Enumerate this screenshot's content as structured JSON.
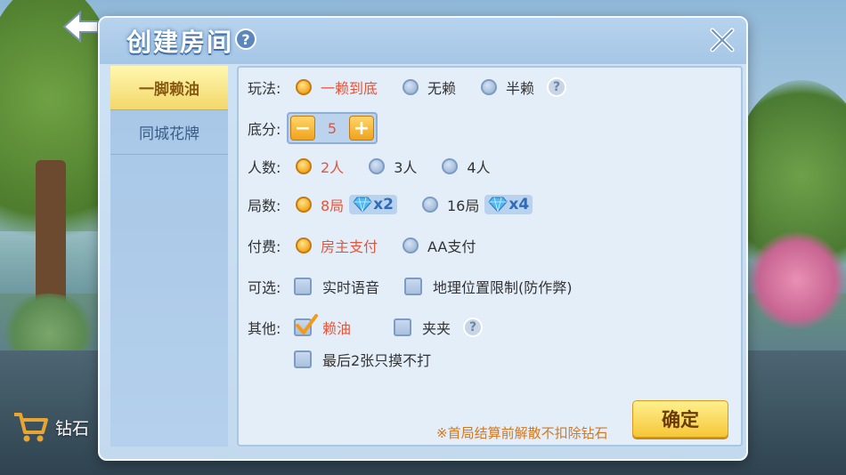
{
  "shop": {
    "label": "钻石"
  },
  "dialog": {
    "title": "创建房间",
    "title_help": "?",
    "tabs": [
      {
        "label": "一脚赖油",
        "active": true
      },
      {
        "label": "同城花牌",
        "active": false
      }
    ]
  },
  "form": {
    "wanfa": {
      "label": "玩法:",
      "options": [
        {
          "label": "一赖到底",
          "selected": true
        },
        {
          "label": "无赖",
          "selected": false
        },
        {
          "label": "半赖",
          "selected": false
        }
      ],
      "help": "?"
    },
    "difen": {
      "label": "底分:",
      "value": "5",
      "minus": "−",
      "plus": "+"
    },
    "renshu": {
      "label": "人数:",
      "options": [
        {
          "label": "2人",
          "selected": true
        },
        {
          "label": "3人",
          "selected": false
        },
        {
          "label": "4人",
          "selected": false
        }
      ]
    },
    "jushu": {
      "label": "局数:",
      "options": [
        {
          "label": "8局",
          "selected": true,
          "cost": "x2"
        },
        {
          "label": "16局",
          "selected": false,
          "cost": "x4"
        }
      ]
    },
    "fufei": {
      "label": "付费:",
      "options": [
        {
          "label": "房主支付",
          "selected": true
        },
        {
          "label": "AA支付",
          "selected": false
        }
      ]
    },
    "kexuan": {
      "label": "可选:",
      "options": [
        {
          "label": "实时语音",
          "checked": false
        },
        {
          "label": "地理位置限制(防作弊)",
          "checked": false
        }
      ]
    },
    "qita": {
      "label": "其他:",
      "options": [
        {
          "label": "赖油",
          "checked": true
        },
        {
          "label": "夹夹",
          "checked": false
        },
        {
          "label": "最后2张只摸不打",
          "checked": false
        }
      ],
      "help": "?"
    }
  },
  "note": "※首局结算前解散不扣除钻石",
  "confirm_label": "确定",
  "colors": {
    "accent": "#f6c737",
    "selected_text": "#e4553b",
    "note": "#d4771e"
  }
}
